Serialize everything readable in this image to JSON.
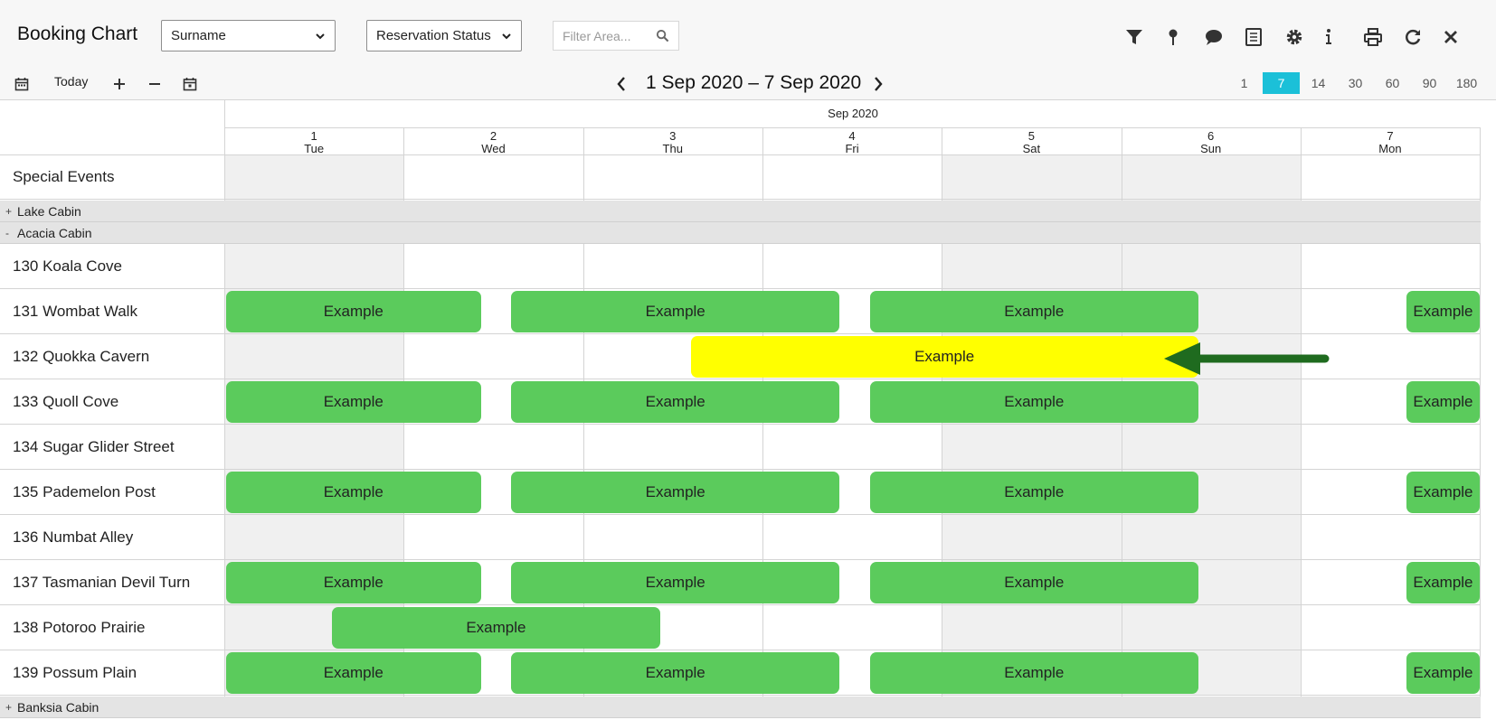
{
  "header": {
    "title": "Booking Chart",
    "surname_select": "Surname",
    "status_select": "Reservation Status",
    "filter_placeholder": "Filter Area..."
  },
  "toolbar_icons": [
    "filter-icon",
    "map-pin-icon",
    "comment-icon",
    "report-icon",
    "settings-icon",
    "info-icon",
    "print-icon",
    "refresh-icon",
    "close-icon"
  ],
  "nav": {
    "today_label": "Today",
    "range_label": "1 Sep 2020 – 7 Sep 2020",
    "views": [
      "1",
      "7",
      "14",
      "30",
      "60",
      "90",
      "180"
    ],
    "active_view": "7"
  },
  "calendar": {
    "month": "Sep 2020",
    "days": [
      {
        "num": "1",
        "dow": "Tue"
      },
      {
        "num": "2",
        "dow": "Wed"
      },
      {
        "num": "3",
        "dow": "Thu"
      },
      {
        "num": "4",
        "dow": "Fri"
      },
      {
        "num": "5",
        "dow": "Sat"
      },
      {
        "num": "6",
        "dow": "Sun"
      },
      {
        "num": "7",
        "dow": "Mon"
      }
    ]
  },
  "rows": {
    "special_events": "Special Events",
    "group_lake": {
      "toggle": "+",
      "label": "Lake Cabin"
    },
    "group_acacia": {
      "toggle": "-",
      "label": "Acacia Cabin"
    },
    "group_banksia": {
      "toggle": "+",
      "label": "Banksia Cabin"
    },
    "units": [
      "130 Koala Cove",
      "131 Wombat Walk",
      "132 Quokka Cavern",
      "133 Quoll Cove",
      "134 Sugar Glider Street",
      "135 Pademelon Post",
      "136 Numbat Alley",
      "137 Tasmanian Devil Turn",
      "138 Potoroo Prairie",
      "139 Possum Plain"
    ]
  },
  "booking_label": "Example",
  "colors": {
    "booking_green": "#5bcb5c",
    "booking_highlight": "#ffff00",
    "active_view": "#1bc0d8",
    "arrow": "#1f6b1f"
  }
}
